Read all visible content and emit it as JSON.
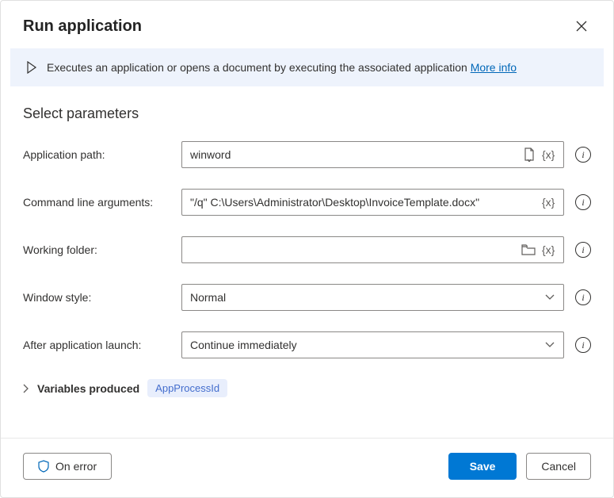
{
  "dialog": {
    "title": "Run application"
  },
  "banner": {
    "text": "Executes an application or opens a document by executing the associated application",
    "link_label": "More info"
  },
  "section": {
    "title": "Select parameters"
  },
  "fields": {
    "app_path": {
      "label": "Application path:",
      "value": "winword"
    },
    "cmd_args": {
      "label": "Command line arguments:",
      "value": "\"/q\" C:\\Users\\Administrator\\Desktop\\InvoiceTemplate.docx\""
    },
    "working_folder": {
      "label": "Working folder:",
      "value": ""
    },
    "window_style": {
      "label": "Window style:",
      "value": "Normal"
    },
    "after_launch": {
      "label": "After application launch:",
      "value": "Continue immediately"
    }
  },
  "variables": {
    "label": "Variables produced",
    "items": [
      "AppProcessId"
    ]
  },
  "footer": {
    "on_error": "On error",
    "save": "Save",
    "cancel": "Cancel"
  }
}
